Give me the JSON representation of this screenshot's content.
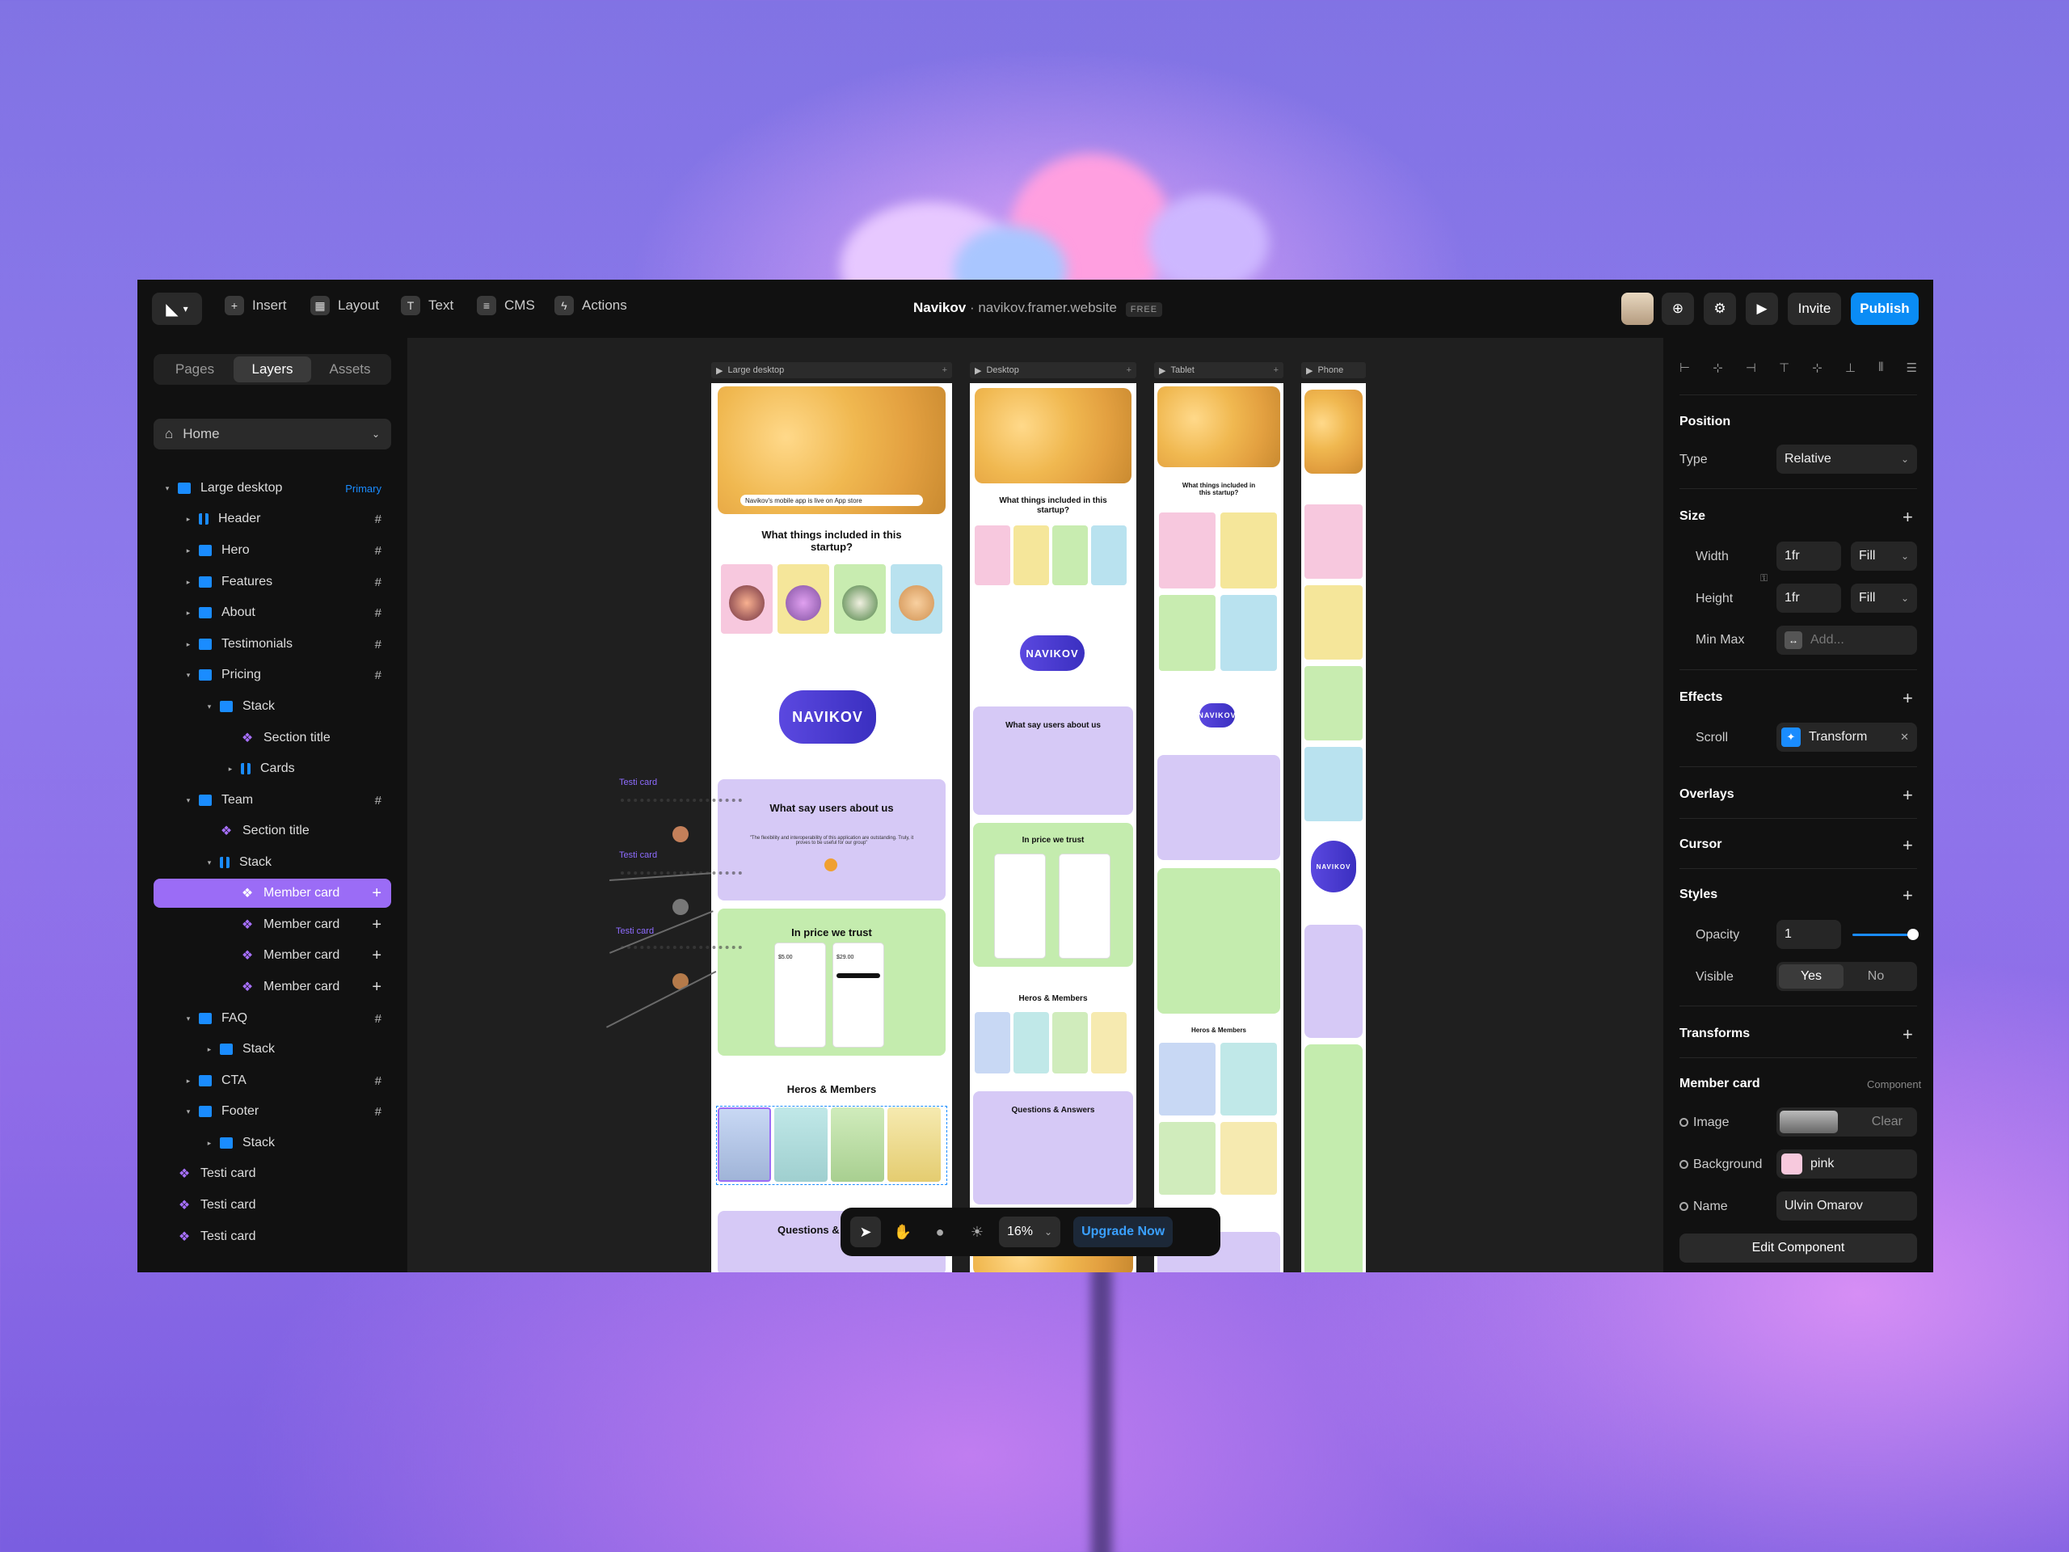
{
  "toolbar": {
    "insert": "Insert",
    "layout": "Layout",
    "text": "Text",
    "cms": "CMS",
    "actions": "Actions",
    "project_name": "Navikov",
    "separator": "·",
    "site_url": "navikov.framer.website",
    "plan_badge": "FREE",
    "invite": "Invite",
    "publish": "Publish"
  },
  "left_panel": {
    "tabs": [
      "Pages",
      "Layers",
      "Assets"
    ],
    "active_tab": "Layers",
    "page_select": "Home",
    "layers": [
      {
        "label": "Large desktop",
        "badge": "Primary"
      },
      {
        "label": "Header"
      },
      {
        "label": "Hero"
      },
      {
        "label": "Features"
      },
      {
        "label": "About"
      },
      {
        "label": "Testimonials"
      },
      {
        "label": "Pricing"
      },
      {
        "label": "Stack"
      },
      {
        "label": "Section title"
      },
      {
        "label": "Cards"
      },
      {
        "label": "Team"
      },
      {
        "label": "Section title"
      },
      {
        "label": "Stack"
      },
      {
        "label": "Member card"
      },
      {
        "label": "Member card"
      },
      {
        "label": "Member card"
      },
      {
        "label": "Member card"
      },
      {
        "label": "FAQ"
      },
      {
        "label": "Stack"
      },
      {
        "label": "CTA"
      },
      {
        "label": "Footer"
      },
      {
        "label": "Stack"
      },
      {
        "label": "Testi card"
      },
      {
        "label": "Testi card"
      },
      {
        "label": "Testi card"
      }
    ]
  },
  "canvas": {
    "frames": [
      "Large desktop",
      "Desktop",
      "Tablet",
      "Phone"
    ],
    "testi_labels": [
      "Testi card",
      "Testi card",
      "Testi card"
    ],
    "mockup": {
      "banner": "Navikov's mobile app is live on App store",
      "features_title": "What things included in this startup?",
      "logo": "NAVIKOV",
      "testimonials_title": "What say users about us",
      "quote": "\"The flexibility and interoperability of this application are outstanding. Truly, it proves to be useful for our group\"",
      "pricing_title": "In price we trust",
      "price_a": "$5.00",
      "price_b": "$29.00",
      "team_title": "Heros & Members",
      "faq_title": "Questions & Answers"
    },
    "zoom": "16%",
    "upgrade": "Upgrade Now"
  },
  "right_panel": {
    "position": {
      "title": "Position",
      "type_label": "Type",
      "type_value": "Relative"
    },
    "size": {
      "title": "Size",
      "width_label": "Width",
      "width_value": "1fr",
      "width_mode": "Fill",
      "height_label": "Height",
      "height_value": "1fr",
      "height_mode": "Fill",
      "minmax_label": "Min Max",
      "minmax_placeholder": "Add..."
    },
    "effects": {
      "title": "Effects",
      "scroll_label": "Scroll",
      "scroll_value": "Transform"
    },
    "overlays": "Overlays",
    "cursor": "Cursor",
    "styles": {
      "title": "Styles",
      "opacity_label": "Opacity",
      "opacity_value": "1",
      "opacity_level": 1.0,
      "visible_label": "Visible",
      "yes": "Yes",
      "no": "No"
    },
    "transforms": "Transforms",
    "component": {
      "title": "Member card",
      "kind": "Component",
      "image_label": "Image",
      "clear": "Clear",
      "background_label": "Background",
      "background_value": "pink",
      "background_color": "#f7c9dd",
      "name_label": "Name",
      "name_value": "Ulvin Omarov",
      "edit": "Edit Component"
    }
  },
  "colors": {
    "accent": "#9b6cf6",
    "publish": "#0a8cf5",
    "frame_blue": "#1a8cff"
  }
}
